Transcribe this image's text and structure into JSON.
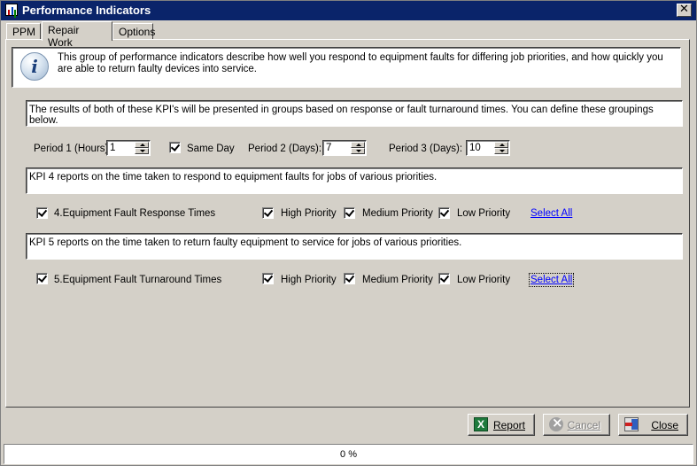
{
  "window": {
    "title": "Performance Indicators",
    "close_glyph": "✕"
  },
  "tabs": [
    {
      "label": "PPM",
      "active": false
    },
    {
      "label": "Repair Work",
      "active": true
    },
    {
      "label": "Options",
      "active": false
    }
  ],
  "info": {
    "icon": "info-icon",
    "text": "This group of performance indicators describe how well you respond to equipment faults for differing job priorities, and how quickly you are able to return faulty devices into service."
  },
  "groupings_text": "The results of both of these KPI's will be presented in groups based on response or fault turnaround times. You can define these groupings below.",
  "periods": {
    "period1": {
      "label": "Period 1 (Hours):",
      "value": "1"
    },
    "same_day": {
      "label": "Same Day",
      "checked": true
    },
    "period2": {
      "label": "Period 2 (Days):",
      "value": "7"
    },
    "period3": {
      "label": "Period 3 (Days):",
      "value": "10"
    }
  },
  "kpi4": {
    "description": "KPI 4  reports on the time taken to respond to equipment faults for jobs of various priorities.",
    "name": "4.Equipment Fault Response Times",
    "checked": true,
    "high": {
      "label": "High Priority",
      "checked": true
    },
    "medium": {
      "label": "Medium Priority",
      "checked": true
    },
    "low": {
      "label": "Low Priority",
      "checked": true
    },
    "select_all": "Select All"
  },
  "kpi5": {
    "description": "KPI 5  reports on the time taken to return faulty equipment to service for jobs of various priorities.",
    "name": "5.Equipment Fault Turnaround Times",
    "checked": true,
    "high": {
      "label": "High Priority",
      "checked": true
    },
    "medium": {
      "label": "Medium Priority",
      "checked": true
    },
    "low": {
      "label": "Low Priority",
      "checked": true
    },
    "select_all": "Select All"
  },
  "buttons": {
    "report": "Report",
    "cancel": "Cancel",
    "close": "Close"
  },
  "status": {
    "progress_text": "0 %",
    "progress": 0
  }
}
